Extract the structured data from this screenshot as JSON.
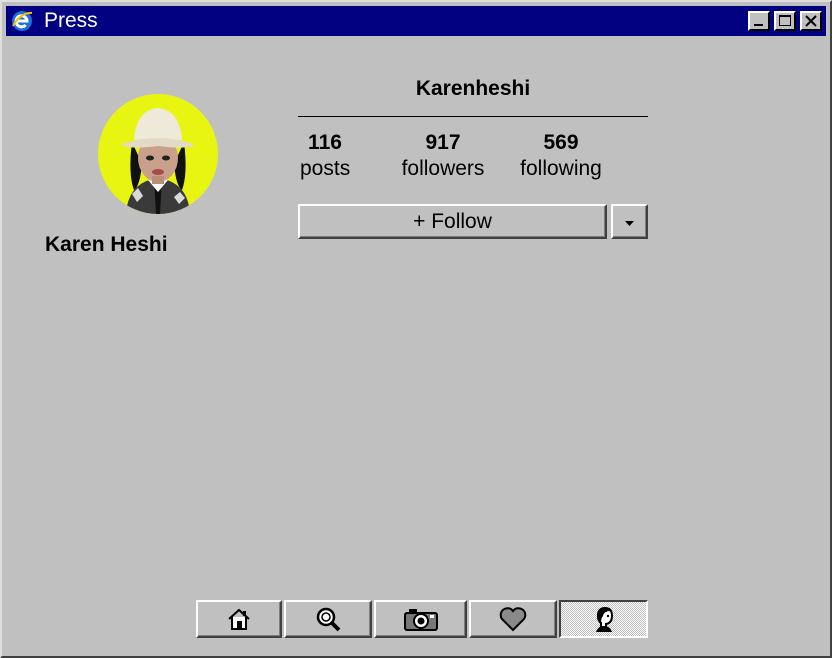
{
  "window": {
    "title": "Press",
    "app_icon": "ie-icon"
  },
  "profile": {
    "username": "Karenheshi",
    "full_name": "Karen Heshi",
    "avatar_bg": "#e8f510",
    "stats": [
      {
        "value": "116",
        "label": "posts"
      },
      {
        "value": "917",
        "label": "followers"
      },
      {
        "value": "569",
        "label": "following"
      }
    ]
  },
  "actions": {
    "follow_label": "+ Follow",
    "dropdown_icon": "triangle-down-icon"
  },
  "nav": [
    {
      "name": "home",
      "icon": "home-icon"
    },
    {
      "name": "search",
      "icon": "search-icon"
    },
    {
      "name": "camera",
      "icon": "camera-icon"
    },
    {
      "name": "activity",
      "icon": "heart-icon"
    },
    {
      "name": "profile",
      "icon": "profile-icon",
      "active": true
    }
  ]
}
